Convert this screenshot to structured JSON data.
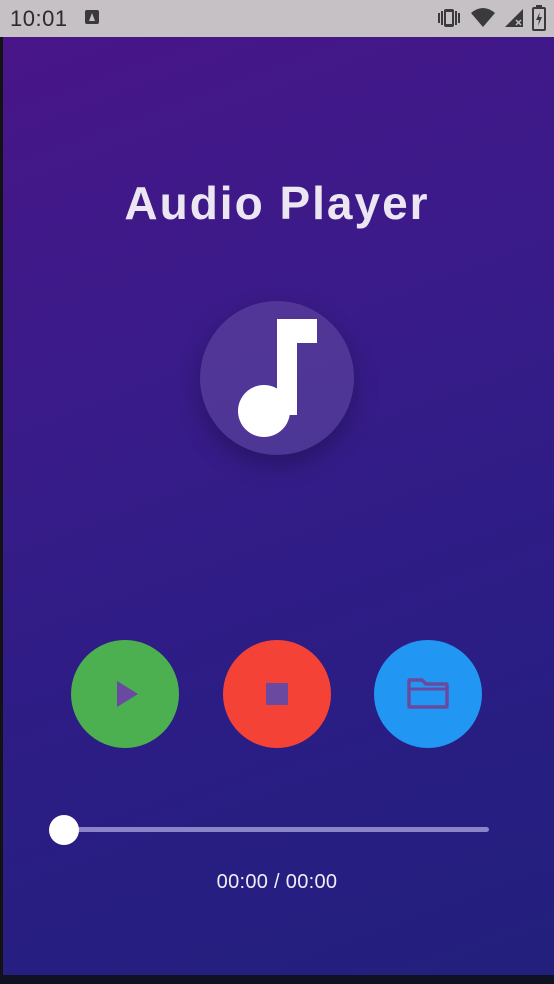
{
  "status_bar": {
    "time": "10:01",
    "icons": [
      "notification-a-icon",
      "vibrate-icon",
      "wifi-icon",
      "signal-icon",
      "battery-icon"
    ]
  },
  "app": {
    "title": "Audio Player",
    "music_icon": "music-note-icon"
  },
  "controls": {
    "play": {
      "icon": "play-icon",
      "color": "#4caf50"
    },
    "stop": {
      "icon": "stop-icon",
      "color": "#f44336"
    },
    "folder": {
      "icon": "folder-icon",
      "color": "#2196f3"
    }
  },
  "seek": {
    "progress": 0,
    "time_text": "00:00 / 00:00"
  },
  "colors": {
    "background_top": "#4a1589",
    "background_bottom": "#22207c",
    "icon_tint": "#6a4aa0"
  }
}
